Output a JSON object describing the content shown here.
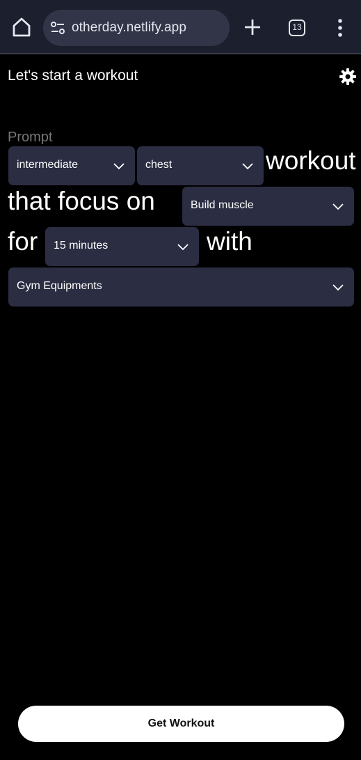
{
  "browser": {
    "url": "otherday.netlify.app",
    "tab_count": "13",
    "icons": [
      "home-icon",
      "site-settings-icon",
      "plus-icon",
      "tabs-icon",
      "more-vert-icon"
    ]
  },
  "header": {
    "title": "Let's start a workout",
    "settings_icon": "gear-icon"
  },
  "prompt": {
    "label": "Prompt",
    "level_select": "intermediate",
    "muscle_select": "chest",
    "text_workout": "workout",
    "text_focus": "that focus on",
    "goal_select": "Build muscle",
    "text_for": "for",
    "duration_select": "15 minutes",
    "text_with": "with",
    "equipment_select": "Gym Equipments"
  },
  "footer": {
    "button_label": "Get Workout"
  },
  "colors": {
    "background": "#000000",
    "select_bg": "#2b2d42",
    "browser_bar": "#1c1f2e",
    "url_box": "#323547",
    "button_bg": "#ffffff",
    "prompt_label": "#777777"
  }
}
